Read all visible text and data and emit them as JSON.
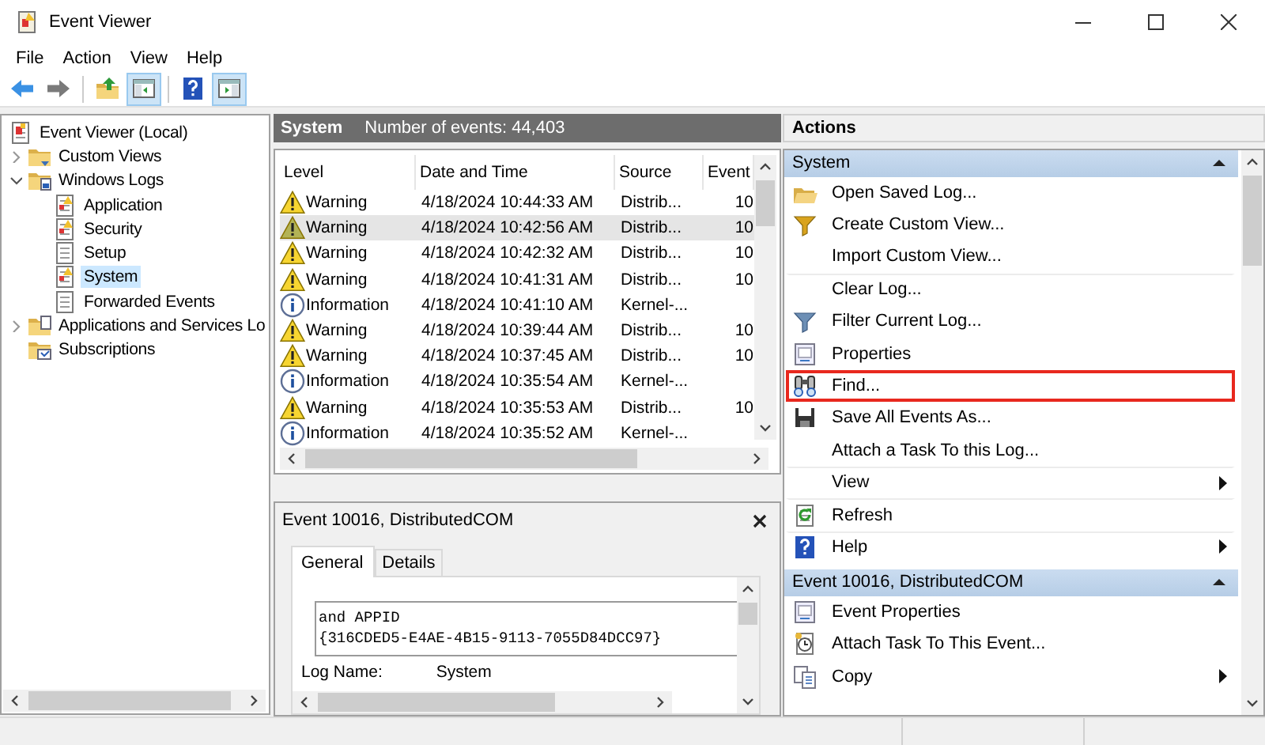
{
  "window": {
    "title": "Event Viewer"
  },
  "menu": [
    "File",
    "Action",
    "View",
    "Help"
  ],
  "toolbar": [
    {
      "kind": "back",
      "pressed": false
    },
    {
      "kind": "forward",
      "pressed": false
    },
    {
      "kind": "up",
      "pressed": false
    },
    {
      "kind": "tree-toggle",
      "pressed": true
    },
    {
      "kind": "help",
      "pressed": false
    },
    {
      "kind": "pane-toggle",
      "pressed": true
    }
  ],
  "tree": {
    "label": "Event Viewer (Local)",
    "kind": "root",
    "selected": false,
    "children": [
      {
        "label": "Custom Views",
        "kind": "folder",
        "selected": false,
        "expanded": false
      },
      {
        "label": "Windows Logs",
        "kind": "folder-logs",
        "selected": false,
        "expanded": true,
        "children": [
          {
            "label": "Application",
            "kind": "log-alert",
            "selected": false
          },
          {
            "label": "Security",
            "kind": "log-alert",
            "selected": false
          },
          {
            "label": "Setup",
            "kind": "log",
            "selected": false
          },
          {
            "label": "System",
            "kind": "log-alert",
            "selected": true
          },
          {
            "label": "Forwarded Events",
            "kind": "log",
            "selected": false
          }
        ]
      },
      {
        "label": "Applications and Services Lo",
        "kind": "folder-doc",
        "selected": false,
        "expanded": false
      },
      {
        "label": "Subscriptions",
        "kind": "subscription",
        "selected": false
      }
    ]
  },
  "events": {
    "log": "System",
    "count": "Number of events: 44,403",
    "columns": [
      "Level",
      "Date and Time",
      "Source",
      "Event"
    ],
    "rows": [
      {
        "kind": "warning",
        "level": "Warning",
        "date": "4/18/2024 10:44:33 AM",
        "source": "Distrib...",
        "event": "10",
        "selected": false
      },
      {
        "kind": "warning",
        "level": "Warning",
        "date": "4/18/2024 10:42:56 AM",
        "source": "Distrib...",
        "event": "10",
        "selected": true
      },
      {
        "kind": "warning",
        "level": "Warning",
        "date": "4/18/2024 10:42:32 AM",
        "source": "Distrib...",
        "event": "10",
        "selected": false
      },
      {
        "kind": "warning",
        "level": "Warning",
        "date": "4/18/2024 10:41:31 AM",
        "source": "Distrib...",
        "event": "10",
        "selected": false
      },
      {
        "kind": "information",
        "level": "Information",
        "date": "4/18/2024 10:41:10 AM",
        "source": "Kernel-...",
        "event": "",
        "selected": false
      },
      {
        "kind": "warning",
        "level": "Warning",
        "date": "4/18/2024 10:39:44 AM",
        "source": "Distrib...",
        "event": "10",
        "selected": false
      },
      {
        "kind": "warning",
        "level": "Warning",
        "date": "4/18/2024 10:37:45 AM",
        "source": "Distrib...",
        "event": "10",
        "selected": false
      },
      {
        "kind": "information",
        "level": "Information",
        "date": "4/18/2024 10:35:54 AM",
        "source": "Kernel-...",
        "event": "",
        "selected": false
      },
      {
        "kind": "warning",
        "level": "Warning",
        "date": "4/18/2024 10:35:53 AM",
        "source": "Distrib...",
        "event": "10",
        "selected": false
      },
      {
        "kind": "information",
        "level": "Information",
        "date": "4/18/2024 10:35:52 AM",
        "source": "Kernel-...",
        "event": "",
        "selected": false
      }
    ]
  },
  "detail": {
    "title": "Event 10016, DistributedCOM",
    "tabs": [
      {
        "label": "General",
        "selected": true
      },
      {
        "label": "Details",
        "selected": false
      }
    ],
    "text_lines": [
      "and APPID",
      "{316CDED5-E4AE-4B15-9113-7055D84DCC97}"
    ],
    "fields": [
      {
        "label": "Log Name:",
        "value": "System"
      }
    ]
  },
  "actions": {
    "title": "Actions",
    "sections": [
      {
        "title": "System",
        "expanded": true,
        "items": [
          {
            "label": "Open Saved Log...",
            "kind": "open",
            "submenu": false,
            "separator": false,
            "highlighted": false
          },
          {
            "label": "Create Custom View...",
            "kind": "funnel",
            "submenu": false,
            "separator": false,
            "highlighted": false
          },
          {
            "label": "Import Custom View...",
            "kind": "none",
            "submenu": false,
            "separator": false,
            "highlighted": false
          },
          {
            "label": "Clear Log...",
            "kind": "none",
            "submenu": false,
            "separator": true,
            "highlighted": false
          },
          {
            "label": "Filter Current Log...",
            "kind": "filter",
            "submenu": false,
            "separator": false,
            "highlighted": false
          },
          {
            "label": "Properties",
            "kind": "properties",
            "submenu": false,
            "separator": false,
            "highlighted": false
          },
          {
            "label": "Find...",
            "kind": "find",
            "submenu": false,
            "separator": false,
            "highlighted": true
          },
          {
            "label": "Save All Events As...",
            "kind": "save",
            "submenu": false,
            "separator": false,
            "highlighted": false
          },
          {
            "label": "Attach a Task To this Log...",
            "kind": "none",
            "submenu": false,
            "separator": false,
            "highlighted": false
          },
          {
            "label": "View",
            "kind": "none",
            "submenu": true,
            "separator": true,
            "highlighted": false
          },
          {
            "label": "Refresh",
            "kind": "refresh",
            "submenu": false,
            "separator": true,
            "highlighted": false
          },
          {
            "label": "Help",
            "kind": "help",
            "submenu": true,
            "separator": true,
            "highlighted": false
          }
        ]
      },
      {
        "title": "Event 10016, DistributedCOM",
        "expanded": true,
        "items": [
          {
            "label": "Event Properties",
            "kind": "properties",
            "submenu": false,
            "separator": false,
            "highlighted": false
          },
          {
            "label": "Attach Task To This Event...",
            "kind": "task",
            "submenu": false,
            "separator": false,
            "highlighted": false
          },
          {
            "label": "Copy",
            "kind": "copy",
            "submenu": true,
            "separator": false,
            "highlighted": false
          }
        ]
      }
    ]
  }
}
